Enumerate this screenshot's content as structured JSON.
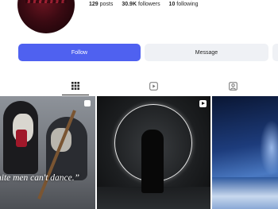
{
  "profile": {
    "stats": {
      "posts_count": "129",
      "posts_label": "posts",
      "followers_count": "30.9K",
      "followers_label": "followers",
      "following_count": "10",
      "following_label": "following"
    }
  },
  "actions": {
    "follow_label": "Follow",
    "message_label": "Message"
  },
  "tabs": [
    {
      "icon": "grid-icon",
      "active": true
    },
    {
      "icon": "reels-icon",
      "active": false
    },
    {
      "icon": "tagged-icon",
      "active": false
    }
  ],
  "posts": [
    {
      "caption": "hite men can't dance.”",
      "badge_icon": "carousel-icon"
    },
    {
      "caption": "",
      "badge_icon": "reel-play-icon"
    },
    {
      "caption": "",
      "badge_icon": ""
    }
  ],
  "colors": {
    "accent": "#4f61f0",
    "secondary_button": "#eff1f5",
    "text": "#262626"
  }
}
